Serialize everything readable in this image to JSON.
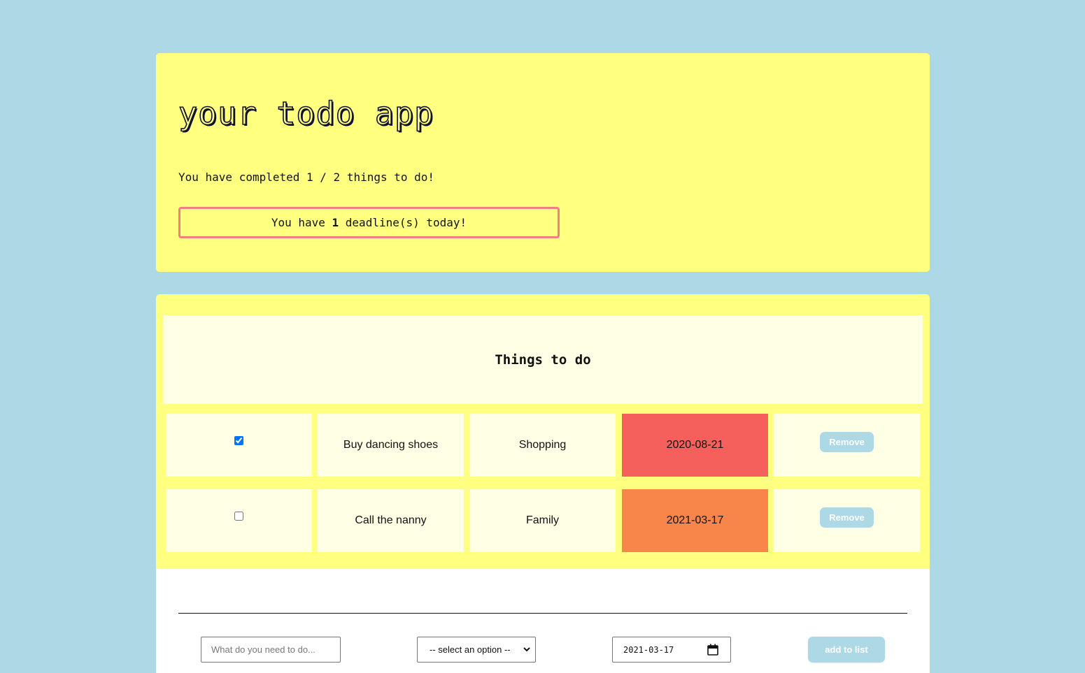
{
  "app": {
    "title": "your todo app",
    "completed_message": "You have completed 1 / 2 things to do!",
    "deadline_prefix": "You have ",
    "deadline_count": "1",
    "deadline_suffix": " deadline(s) today!"
  },
  "list": {
    "heading": "Things to do",
    "items": [
      {
        "done": true,
        "task": "Buy dancing shoes",
        "category": "Shopping",
        "date": "2020-08-21",
        "date_color": "#f5605c",
        "remove_label": "Remove"
      },
      {
        "done": false,
        "task": "Call the nanny",
        "category": "Family",
        "date": "2021-03-17",
        "date_color": "#f8864a",
        "remove_label": "Remove"
      }
    ]
  },
  "form": {
    "task_placeholder": "What do you need to do...",
    "category_selected": "-- select an option --",
    "date_value": "2021-03-17",
    "add_label": "add to list"
  },
  "colors": {
    "background": "#add8e6",
    "card": "#ffff80",
    "cell": "#ffffe6",
    "deadline_border": "#f08080",
    "button": "#add8e6"
  }
}
